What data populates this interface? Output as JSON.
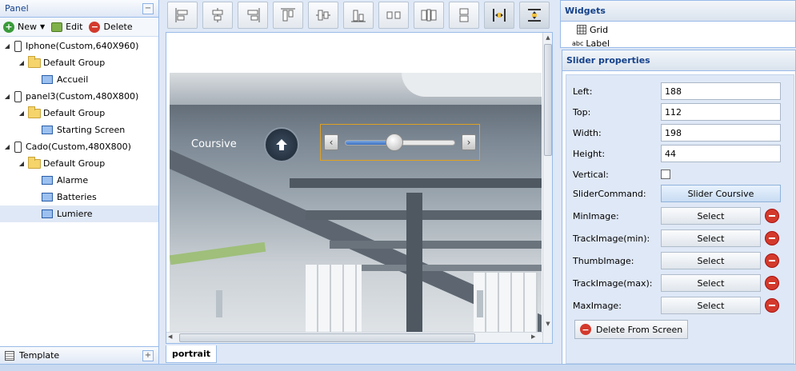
{
  "left_panel": {
    "title": "Panel",
    "collapse_symbol": "−",
    "toolbar": {
      "new_label": "New",
      "edit_label": "Edit",
      "delete_label": "Delete"
    },
    "tree": [
      {
        "label": "Iphone(Custom,640X960)",
        "type": "device",
        "level": 0
      },
      {
        "label": "Default Group",
        "type": "group",
        "level": 1
      },
      {
        "label": "Accueil",
        "type": "screen",
        "level": 2
      },
      {
        "label": "panel3(Custom,480X800)",
        "type": "device",
        "level": 0
      },
      {
        "label": "Default Group",
        "type": "group",
        "level": 1
      },
      {
        "label": "Starting Screen",
        "type": "screen",
        "level": 2
      },
      {
        "label": "Cado(Custom,480X800)",
        "type": "device",
        "level": 0
      },
      {
        "label": "Default Group",
        "type": "group",
        "level": 1
      },
      {
        "label": "Alarme",
        "type": "screen",
        "level": 2
      },
      {
        "label": "Batteries",
        "type": "screen",
        "level": 2
      },
      {
        "label": "Lumiere",
        "type": "screen",
        "level": 2,
        "selected": true
      }
    ],
    "template_label": "Template",
    "template_add_symbol": "+"
  },
  "canvas": {
    "slider_label": "Coursive",
    "tab_label": "portrait",
    "slider_fraction": 0.45
  },
  "widgets": {
    "title": "Widgets",
    "items": [
      {
        "label": "Grid",
        "icon": "grid-icon"
      },
      {
        "label": "Label",
        "prefix": "abc"
      }
    ]
  },
  "slider_properties": {
    "title": "Slider properties",
    "left_label": "Left:",
    "left_value": "188",
    "top_label": "Top:",
    "top_value": "112",
    "width_label": "Width:",
    "width_value": "198",
    "height_label": "Height:",
    "height_value": "44",
    "vertical_label": "Vertical:",
    "command_label": "SliderCommand:",
    "command_value": "Slider Coursive",
    "min_image_label": "MinImage:",
    "track_min_label": "TrackImage(min):",
    "thumb_label": "ThumbImage:",
    "track_max_label": "TrackImage(max):",
    "max_image_label": "MaxImage:",
    "select_label": "Select",
    "delete_from_screen_label": "Delete From Screen"
  },
  "colors": {
    "accent": "#15428b",
    "selected_row": "#dfe8f6",
    "slider_border": "#e0a020",
    "delete_red": "#d33a2c"
  }
}
